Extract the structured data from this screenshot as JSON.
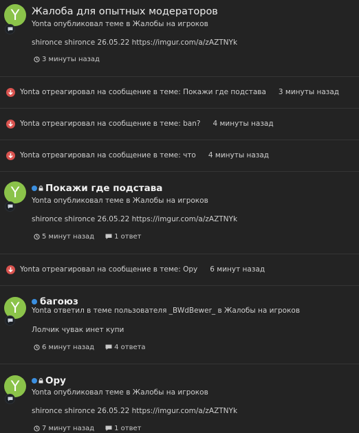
{
  "colors": {
    "background": "#232323",
    "avatar": "#8bc34a",
    "unread_dot": "#3b8fe0",
    "reaction_badge": "#d9534f"
  },
  "icons": {
    "clock": "clock-icon",
    "reply": "comment-icon",
    "reaction": "thumbs-down-icon",
    "thread_type": "chat-bubble-icon",
    "lock": "lock-icon"
  },
  "feed": [
    {
      "kind": "post",
      "avatar_letter": "Y",
      "title": "Жалоба для опытных модераторов",
      "unread": false,
      "locked": false,
      "meta": "Yonta опубликовал теме в Жалобы на игроков",
      "snippet": "shironce shironce 26.05.22 https://imgur.com/a/zAZTNYk",
      "time": "3 минуты назад",
      "replies": ""
    },
    {
      "kind": "reaction",
      "text": "Yonta отреагировал на сообщение в теме: Покажи где подстава",
      "time": "3 минуты назад"
    },
    {
      "kind": "reaction",
      "text": "Yonta отреагировал на сообщение в теме: ban?",
      "time": "4 минуты назад"
    },
    {
      "kind": "reaction",
      "text": "Yonta отреагировал на сообщение в теме: что",
      "time": "4 минуты назад"
    },
    {
      "kind": "post",
      "avatar_letter": "Y",
      "title": "Покажи где подстава",
      "unread": true,
      "locked": true,
      "meta": "Yonta опубликовал теме в Жалобы на игроков",
      "snippet": "shironce shironce 26.05.22 https://imgur.com/a/zAZTNYk",
      "time": "5 минут назад",
      "replies": "1 ответ"
    },
    {
      "kind": "reaction",
      "text": "Yonta отреагировал на сообщение в теме: Ору",
      "time": "6 минут назад"
    },
    {
      "kind": "post",
      "avatar_letter": "Y",
      "title": "багоюз",
      "unread": true,
      "locked": false,
      "meta": "Yonta ответил в теме пользователя _BWdBewer_ в Жалобы на игроков",
      "snippet": "Лолчик чувак инет купи",
      "time": "6 минут назад",
      "replies": "4 ответа"
    },
    {
      "kind": "post",
      "avatar_letter": "Y",
      "title": "Ору",
      "unread": true,
      "locked": true,
      "meta": "Yonta опубликовал теме в Жалобы на игроков",
      "snippet": "shironce shironce 26.05.22 https://imgur.com/a/zAZTNYk",
      "time": "7 минут назад",
      "replies": "1 ответ"
    }
  ]
}
